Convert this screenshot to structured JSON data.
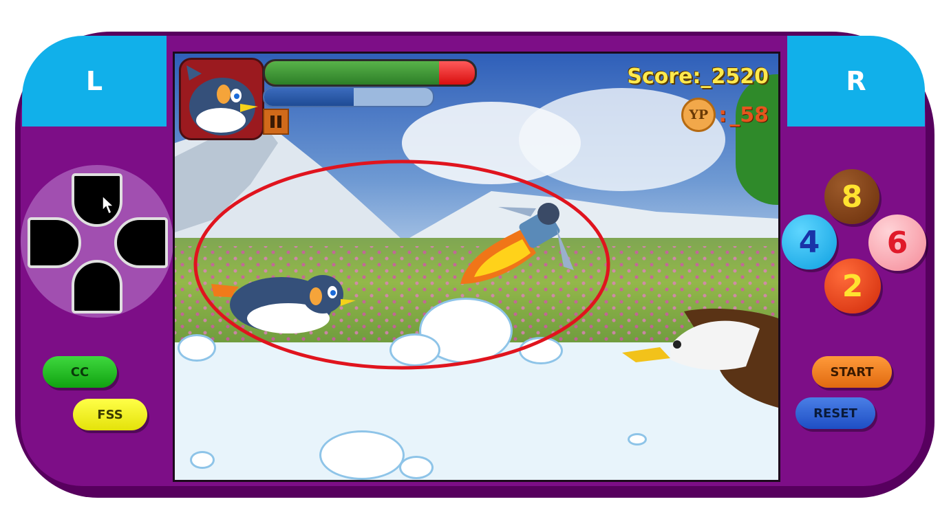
{
  "console": {
    "shoulder_left": "L",
    "shoulder_right": "R",
    "buttons": {
      "cc": "CC",
      "fss": "FSS",
      "start": "START",
      "reset": "RESET"
    },
    "action_buttons": {
      "top": "8",
      "left": "4",
      "right": "6",
      "bottom": "2"
    }
  },
  "hud": {
    "score_text": "Score:_2520",
    "yp_icon": "YP",
    "yp_sep": ":",
    "yp_value": "_58",
    "health_fraction": 0.83,
    "energy_fraction": 0.53,
    "pause_icon": "pause-icon"
  },
  "colors": {
    "console_body": "#7d0e87",
    "shoulder": "#11b0ea",
    "highlight_ring": "#e0141e"
  }
}
